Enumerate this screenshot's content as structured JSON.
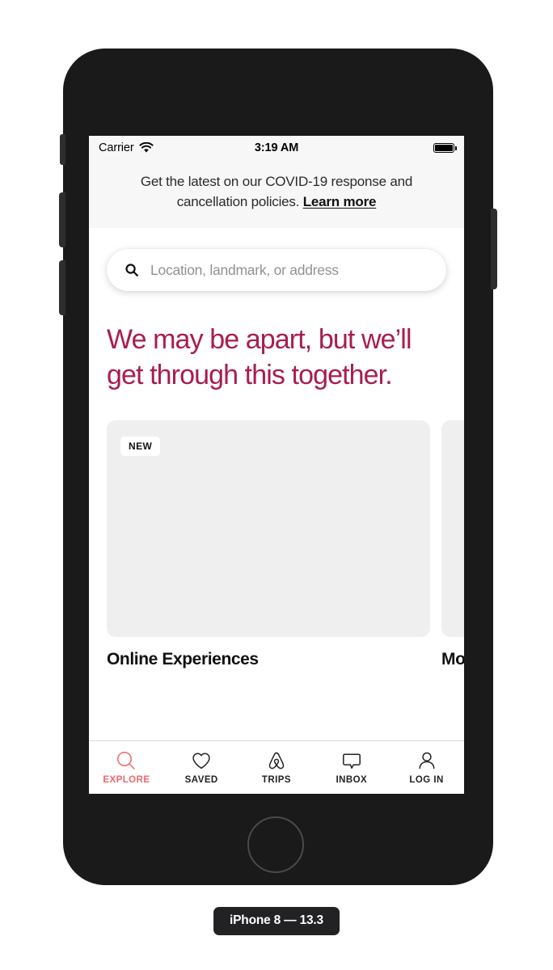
{
  "device": {
    "badge_label": "iPhone 8 — 13.3"
  },
  "status_bar": {
    "carrier": "Carrier",
    "wifi_icon": "wifi-icon",
    "time": "3:19 AM",
    "battery_icon": "battery-full-icon"
  },
  "banner": {
    "line1": "Get the latest on our COVID-19 response and",
    "line2": "cancellation policies.",
    "link_label": "Learn more"
  },
  "search": {
    "icon": "search-icon",
    "placeholder": "Location, landmark, or address",
    "value": ""
  },
  "headline": {
    "text": "We may be apart, but we’ll get through this together."
  },
  "carousel": {
    "cards": [
      {
        "badge": "NEW",
        "title": "Online Experiences"
      },
      {
        "badge": "",
        "title": "Monthly stays"
      }
    ]
  },
  "tab_bar": {
    "items": [
      {
        "label": "EXPLORE",
        "icon": "search-icon",
        "active": true
      },
      {
        "label": "SAVED",
        "icon": "heart-icon",
        "active": false
      },
      {
        "label": "TRIPS",
        "icon": "airbnb-belo-icon",
        "active": false
      },
      {
        "label": "INBOX",
        "icon": "speech-bubble-icon",
        "active": false
      },
      {
        "label": "LOG IN",
        "icon": "person-icon",
        "active": false
      }
    ]
  },
  "colors": {
    "headline": "#a81d4f",
    "active_tab": "#f0676f",
    "banner_bg": "#f7f7f7",
    "card_placeholder": "#efefef"
  }
}
